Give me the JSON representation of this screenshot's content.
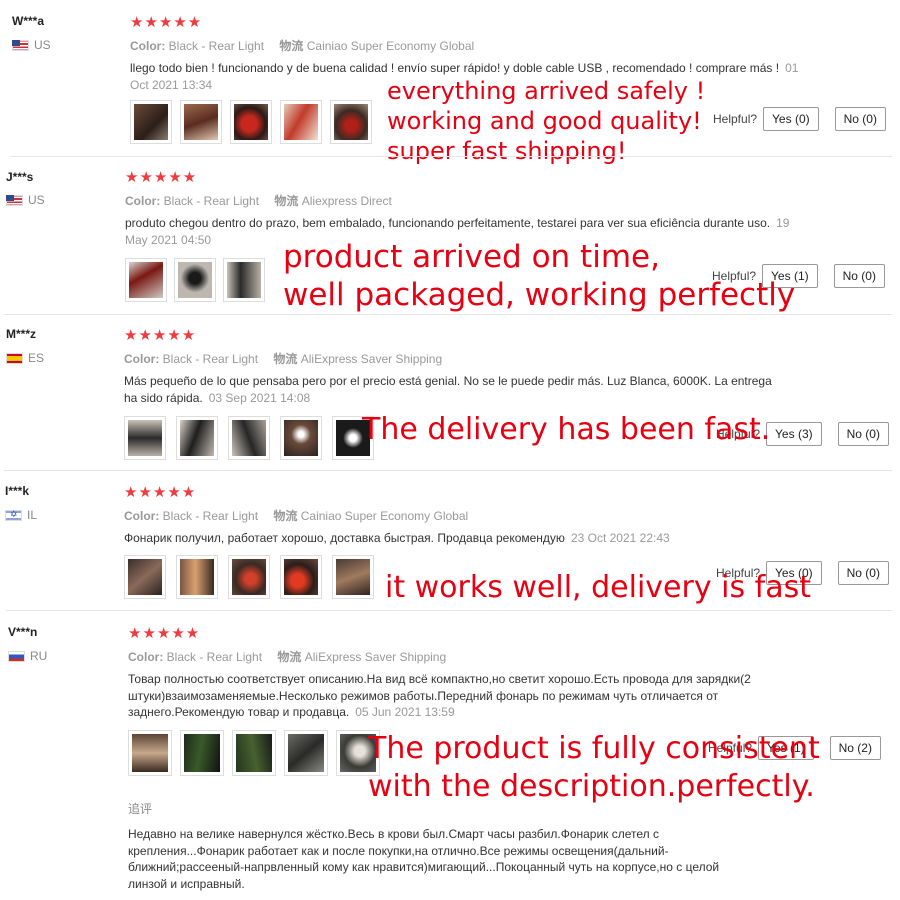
{
  "reviews": [
    {
      "user": "W***a",
      "country": "US",
      "stars": "★★★★★",
      "color_label": "Color:",
      "color_value": "Black - Rear Light",
      "ship_label": "物流",
      "ship_value": "Cainiao Super Economy Global",
      "text": "llego todo bien ! funcionando y de buena calidad ! envío super rápido! y doble cable USB , recomendado ! comprare más !",
      "date": "01 Oct 2021 13:34",
      "helpful_label": "Helpful?",
      "yes": "Yes (0)",
      "no": "No (0)",
      "overlay": [
        "everything arrived safely !",
        "working and good quality!",
        "super fast shipping!"
      ]
    },
    {
      "user": "J***s",
      "country": "US",
      "stars": "★★★★★",
      "color_label": "Color:",
      "color_value": "Black - Rear Light",
      "ship_label": "物流",
      "ship_value": "Aliexpress Direct",
      "text": "produto chegou dentro do prazo, bem embalado, funcionando perfeitamente, testarei para ver sua eficiência durante uso.",
      "date": "19 May 2021 04:50",
      "helpful_label": "Helpful?",
      "yes": "Yes (1)",
      "no": "No (0)",
      "overlay": [
        "product arrived on time,",
        "well packaged, working perfectly"
      ]
    },
    {
      "user": "M***z",
      "country": "ES",
      "stars": "★★★★★",
      "color_label": "Color:",
      "color_value": "Black - Rear Light",
      "ship_label": "物流",
      "ship_value": "AliExpress Saver Shipping",
      "text": "Más pequeño de lo que pensaba pero por el precio está genial. No se le puede pedir más. Luz Blanca, 6000K. La entrega ha sido rápida.",
      "date": "03 Sep 2021 14:08",
      "helpful_label": "Helpful?",
      "yes": "Yes (3)",
      "no": "No (0)",
      "overlay": [
        "The delivery has been fast."
      ]
    },
    {
      "user": "I***k",
      "country": "IL",
      "stars": "★★★★★",
      "color_label": "Color:",
      "color_value": "Black - Rear Light",
      "ship_label": "物流",
      "ship_value": "Cainiao Super Economy Global",
      "text": "Фонарик получил, работает хорошо, доставка быстрая. Продавца рекомендую",
      "date": "23 Oct 2021 22:43",
      "helpful_label": "Helpful?",
      "yes": "Yes (0)",
      "no": "No (0)",
      "overlay": [
        "it works well, delivery is fast"
      ]
    },
    {
      "user": "V***n",
      "country": "RU",
      "stars": "★★★★★",
      "color_label": "Color:",
      "color_value": "Black - Rear Light",
      "ship_label": "物流",
      "ship_value": "AliExpress Saver Shipping",
      "text": "Товар полностью соответствует описанию.На вид всё компактно,но светит хорошо.Есть провода для зарядки(2 штуки)взаимозаменяемые.Несколько режимов работы.Передний фонарь по режимам чуть отличается от заднего.Рекомендую товар и продавца.",
      "date": "05 Jun 2021 13:59",
      "helpful_label": "Helpful?",
      "yes": "Yes (1)",
      "no": "No (2)",
      "overlay": [
        "The product is fully consistent",
        "with the description.perfectly."
      ],
      "followup_label": "追评",
      "followup_text": "Недавно на велике навернулся жёстко.Весь в крови был.Смарт часы разбил.Фонарик слетел с крепления...Фонарик работает как и после покупки,на отлично.Все режимы освещения(дальний-ближний;рассееный-напрвленный кому как нравится)мигающий...Покоцанный чуть на корпусе,но с целой линзой и исправный."
    }
  ]
}
